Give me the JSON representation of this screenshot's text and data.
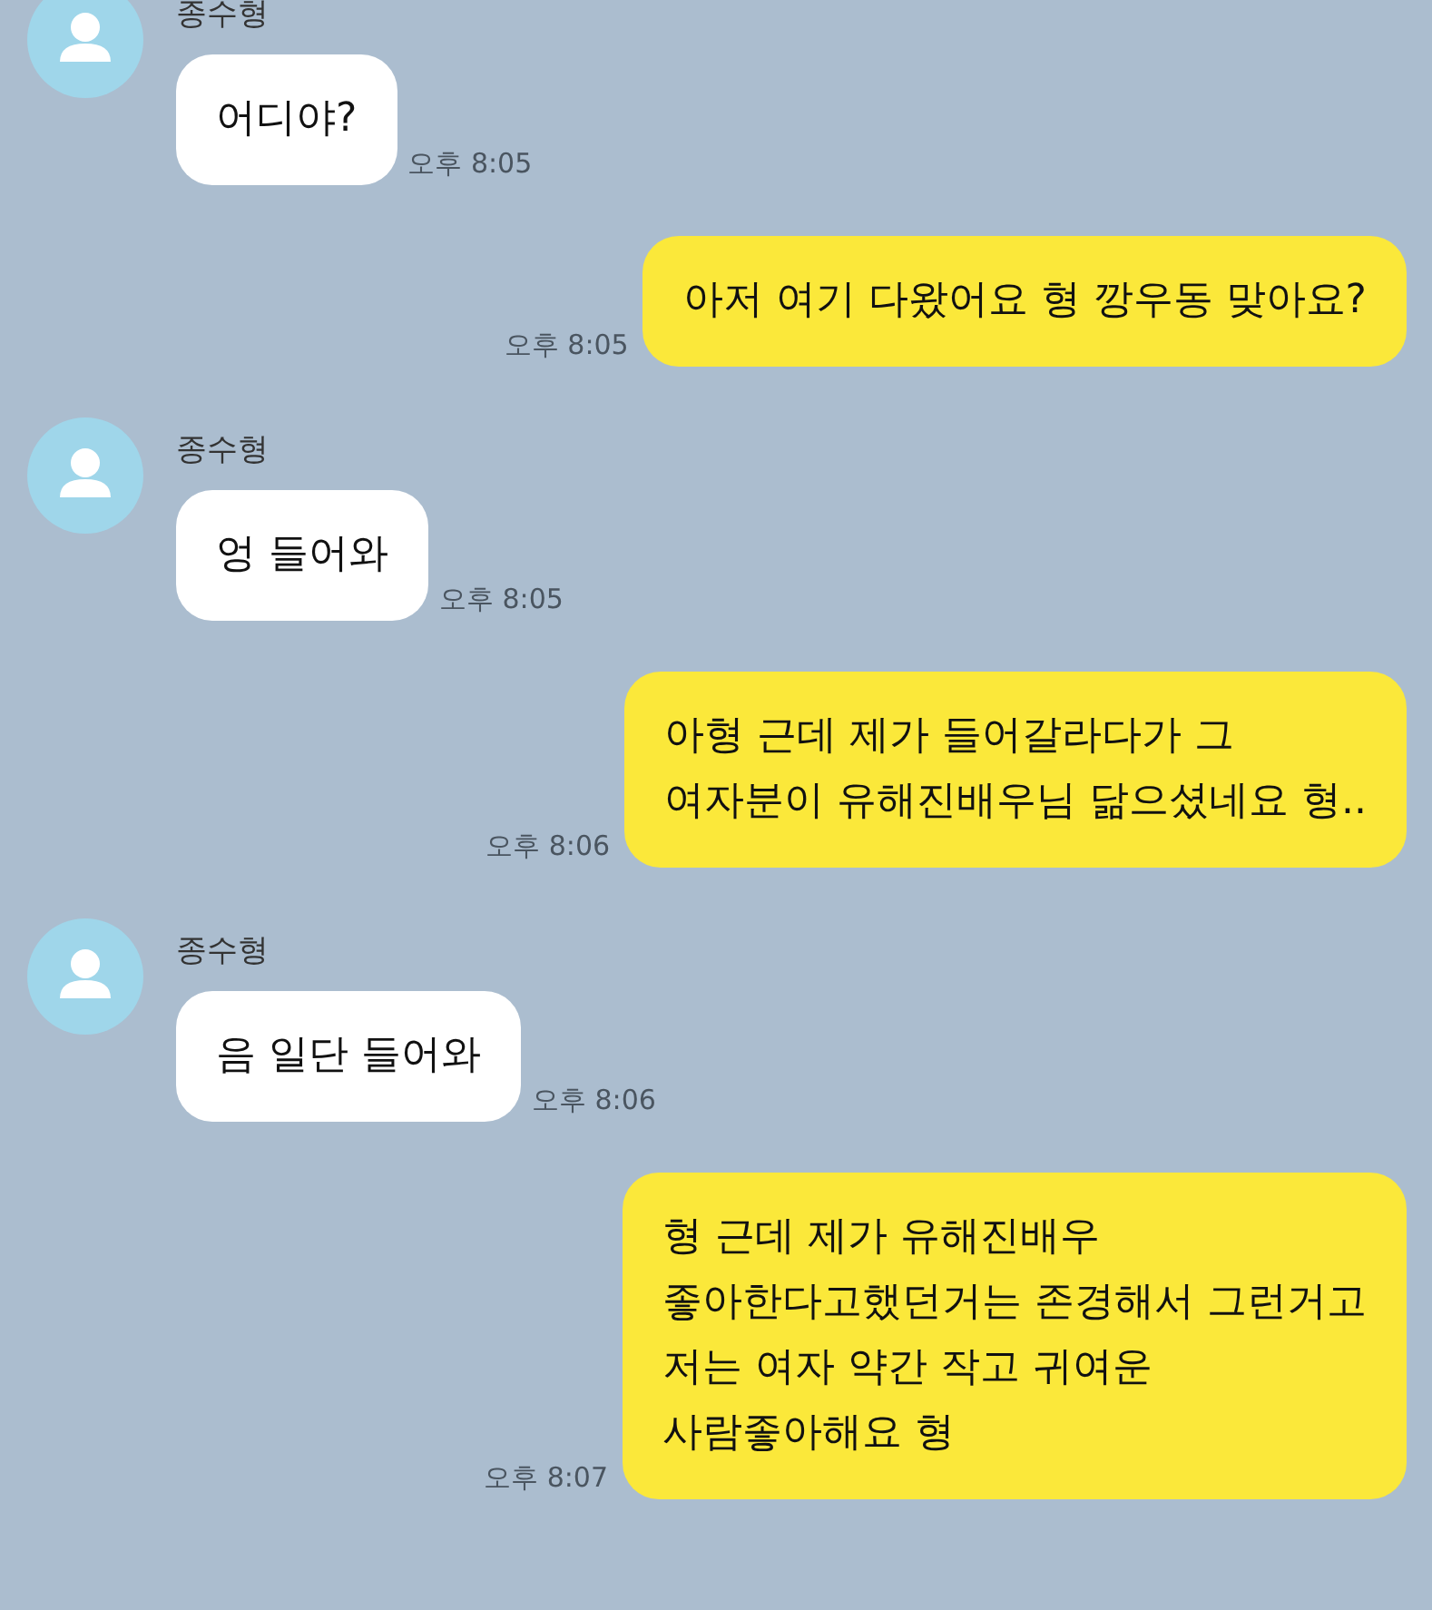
{
  "messages": [
    {
      "kind": "received",
      "sender": "종수형",
      "text": "어디야?",
      "time": "오후 8:05"
    },
    {
      "kind": "sent",
      "text": "아저 여기 다왔어요 형 깡우동 맞아요?",
      "time": "오후 8:05"
    },
    {
      "kind": "received",
      "sender": "종수형",
      "text": "엉 들어와",
      "time": "오후 8:05"
    },
    {
      "kind": "sent",
      "text": "아형 근데 제가 들어갈라다가 그\n여자분이 유해진배우님 닮으셨네요 형..",
      "time": "오후 8:06"
    },
    {
      "kind": "received",
      "sender": "종수형",
      "text": "음 일단 들어와",
      "time": "오후 8:06"
    },
    {
      "kind": "sent",
      "text": "형 근데 제가 유해진배우\n좋아한다고했던거는 존경해서 그런거고\n저는 여자 약간 작고 귀여운\n사람좋아해요 형",
      "time": "오후 8:07"
    }
  ]
}
